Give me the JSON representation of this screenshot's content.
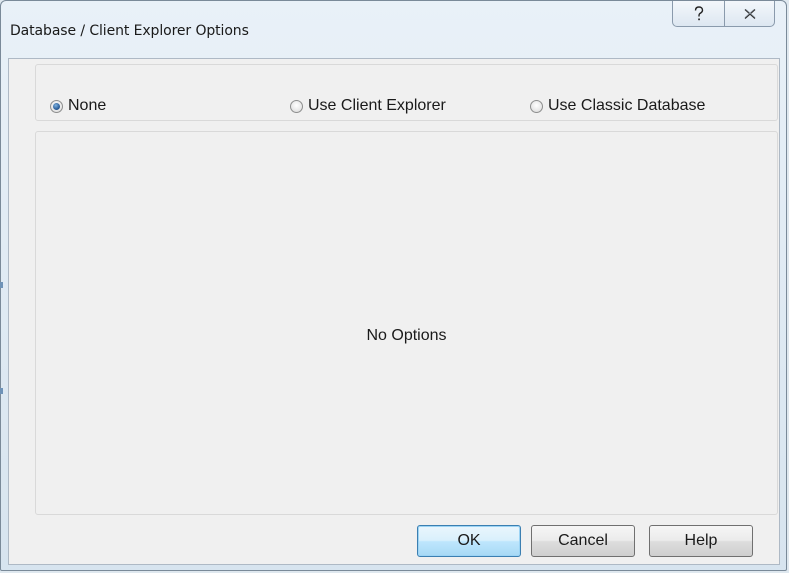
{
  "window": {
    "title": "Database / Client Explorer Options"
  },
  "titlebar_buttons": [
    {
      "name": "help",
      "icon": "question-mark-icon"
    },
    {
      "name": "close",
      "icon": "close-x-icon"
    }
  ],
  "radio": {
    "options": [
      {
        "label": "None",
        "checked": true
      },
      {
        "label": "Use Client Explorer",
        "checked": false
      },
      {
        "label": "Use Classic Database",
        "checked": false
      }
    ]
  },
  "panel": {
    "message": "No Options"
  },
  "buttons": {
    "ok": "OK",
    "cancel": "Cancel",
    "help": "Help"
  },
  "colors": {
    "accent_default_button": "#3c7fb1",
    "radio_checked": "#2c5f9a",
    "client_background": "#f0f0f0"
  }
}
